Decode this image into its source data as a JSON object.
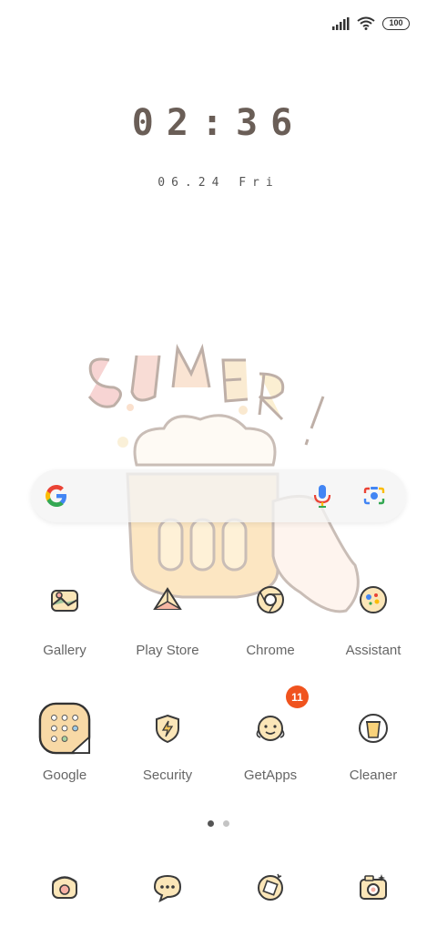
{
  "status_bar": {
    "signal_icon": "signal-bars-icon",
    "wifi_icon": "wifi-icon",
    "battery_level": "100"
  },
  "lockclock": {
    "time": "02:36",
    "date": "06.24 Fri"
  },
  "search_bar": {
    "google_icon": "google-g-icon",
    "mic_icon": "mic-icon",
    "lens_icon": "lens-camera-icon"
  },
  "apps": [
    {
      "label": "Gallery",
      "icon": "gallery-icon"
    },
    {
      "label": "Play Store",
      "icon": "play-store-icon"
    },
    {
      "label": "Chrome",
      "icon": "chrome-icon"
    },
    {
      "label": "Assistant",
      "icon": "assistant-icon"
    },
    {
      "label": "Google",
      "icon": "google-folder-icon"
    },
    {
      "label": "Security",
      "icon": "security-icon"
    },
    {
      "label": "GetApps",
      "icon": "getapps-icon",
      "badge": "11"
    },
    {
      "label": "Cleaner",
      "icon": "cleaner-icon"
    }
  ],
  "page_indicator": {
    "pages": 2,
    "current": 1
  },
  "dock": [
    {
      "icon": "phone-icon"
    },
    {
      "icon": "messages-icon"
    },
    {
      "icon": "browser-icon"
    },
    {
      "icon": "camera-icon"
    }
  ],
  "colors": {
    "icon_fill": "#fbe6b8",
    "icon_stroke": "#3a3a3a",
    "badge": "#f0531e",
    "clock": "#6a5e57"
  }
}
